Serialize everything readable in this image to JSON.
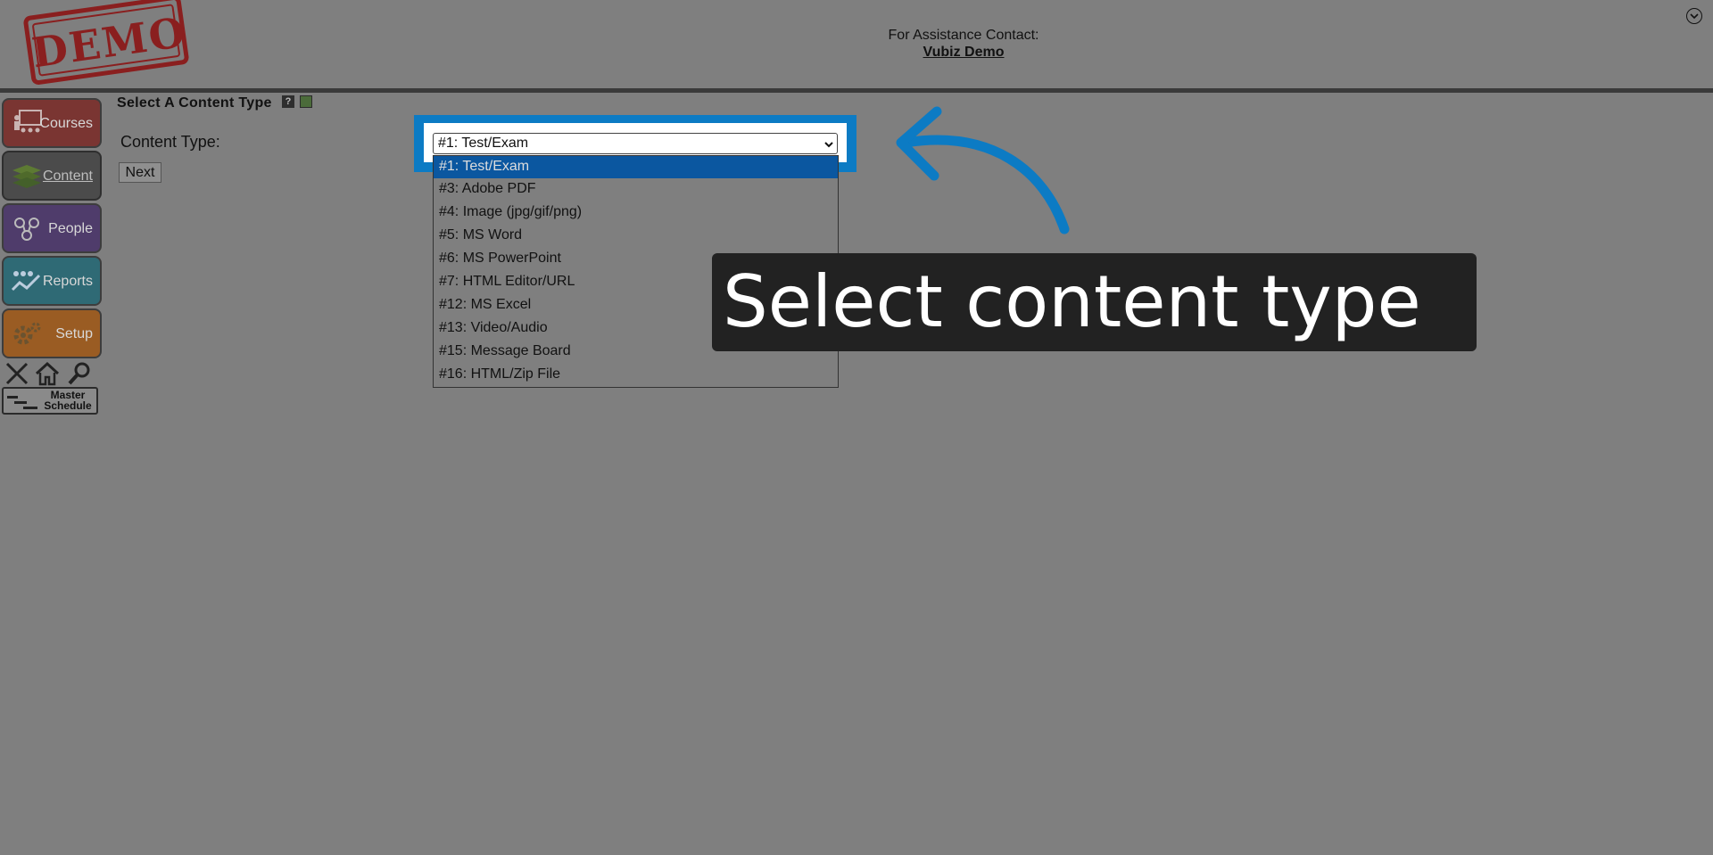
{
  "header": {
    "logo": "DEMO",
    "assist_label": "For Assistance Contact:",
    "contact_name": "Vubiz Demo"
  },
  "sidebar": {
    "items": [
      {
        "label": "Courses",
        "icon": "courses-icon"
      },
      {
        "label": "Content",
        "icon": "content-icon"
      },
      {
        "label": "People",
        "icon": "people-icon"
      },
      {
        "label": "Reports",
        "icon": "reports-icon"
      },
      {
        "label": "Setup",
        "icon": "setup-icon"
      }
    ],
    "tools": [
      "close-icon",
      "home-icon",
      "search-icon"
    ],
    "master_schedule": "Master Schedule"
  },
  "main": {
    "title": "Select A Content Type",
    "help_icon": "?",
    "field_label": "Content Type:",
    "select_value": "#1: Test/Exam",
    "next_label": "Next",
    "dropdown": {
      "selected": "#1: Test/Exam",
      "options": [
        "#3: Adobe PDF",
        "#4: Image (jpg/gif/png)",
        "#5: MS Word",
        "#6: MS PowerPoint",
        "#7: HTML Editor/URL",
        "#12: MS Excel",
        "#13: Video/Audio",
        "#15: Message Board",
        "#16: HTML/Zip File"
      ]
    }
  },
  "overlay": {
    "tooltip": "Select content type",
    "accent": "#0c7bc4"
  }
}
